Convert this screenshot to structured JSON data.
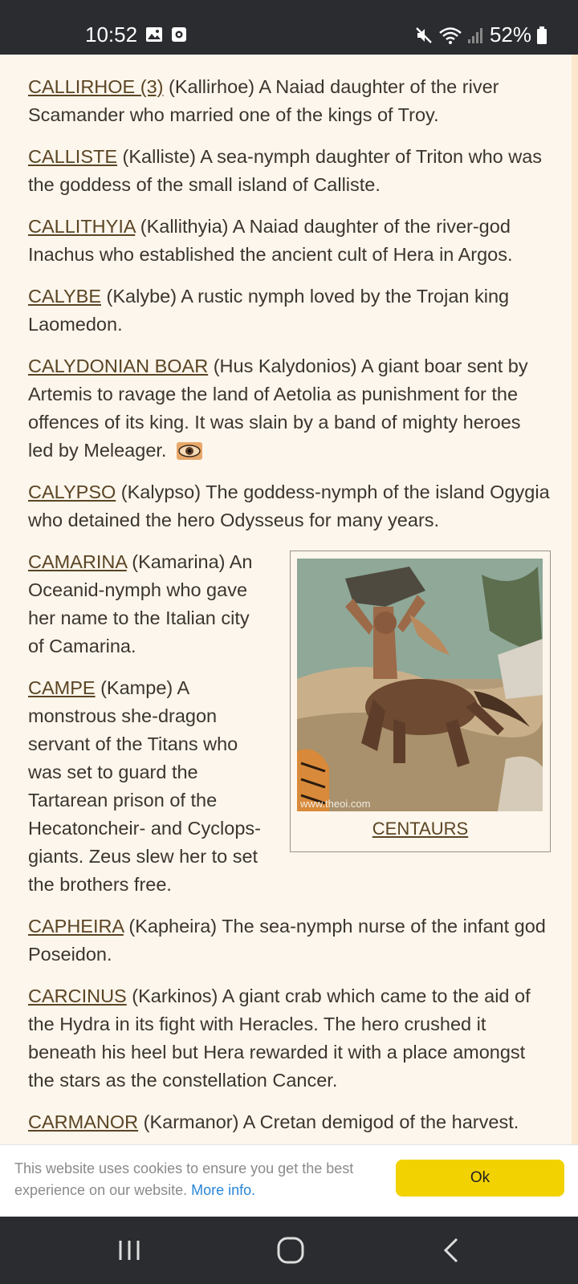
{
  "status_bar": {
    "time": "10:52",
    "battery": "52%",
    "icons_left": [
      "image-icon",
      "screen-record-icon"
    ],
    "icons_right": [
      "mute-icon",
      "wifi-icon",
      "signal-icon",
      "battery-icon"
    ]
  },
  "top_partial_text": "...(partly hidden line)...",
  "entries": [
    {
      "name": "CALLIRHOE (3)",
      "text": " (Kallirhoe) A Naiad daughter of the river Scamander who married one of the kings of Troy."
    },
    {
      "name": "CALLISTE",
      "text": " (Kalliste) A sea-nymph daughter of Triton who was the goddess of the small island of Calliste."
    },
    {
      "name": "CALLITHYIA",
      "text": " (Kallithyia) A Naiad daughter of the river-god Inachus who established the ancient cult of Hera in Argos."
    },
    {
      "name": "CALYBE",
      "text": " (Kalybe) A rustic nymph loved by the Trojan king Laomedon."
    },
    {
      "name": "CALYDONIAN BOAR",
      "text": " (Hus Kalydonios) A giant boar sent by Artemis to ravage the land of Aetolia as punishment for the offences of its king. It was slain by a band of mighty heroes led by Meleager."
    },
    {
      "name": "CALYPSO",
      "text": " (Kalypso) The goddess-nymph of the island Ogygia who detained the hero Odysseus for many years."
    },
    {
      "name": "CAMARINA",
      "text": " (Kamarina) An Oceanid-nymph who gave her name to the Italian city of Camarina."
    },
    {
      "name": "CAMPE",
      "text": " (Kampe) A monstrous she-dragon servant of the Titans who was set to guard the Tartarean prison of the Hecatoncheir- and Cyclops-giants. Zeus slew her to set the brothers free."
    },
    {
      "name": "CAPHEIRA",
      "text": " (Kapheira) The sea-nymph nurse of the infant god Poseidon."
    },
    {
      "name": "CARCINUS",
      "text": " (Karkinos) A giant crab which came to the aid of the Hydra in its fight with Heracles. The hero crushed it beneath his heel but Hera rewarded it with a place amongst the stars as the constellation Cancer."
    },
    {
      "name": "CARMANOR",
      "text": " (Karmanor) A Cretan demigod of the harvest."
    }
  ],
  "figure": {
    "caption": "CENTAURS",
    "watermark": "www.theoi.com"
  },
  "cookie": {
    "text": "This website uses cookies to ensure you get the best experience on our website. ",
    "link": "More info.",
    "ok_label": "Ok"
  },
  "colors": {
    "page_bg": "#fdf6ec",
    "link": "#5a4524",
    "button": "#f2d200",
    "system_bar": "#2b2c30"
  }
}
